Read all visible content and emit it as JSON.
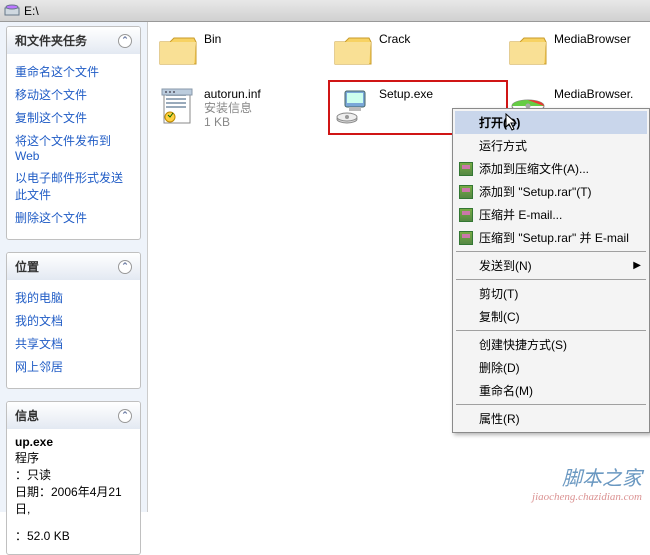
{
  "title": "E:\\",
  "sidebar": {
    "sections": [
      {
        "title": "和文件夹任务",
        "tasks": [
          "重命名这个文件",
          "移动这个文件",
          "复制这个文件",
          "将这个文件发布到 Web",
          "以电子邮件形式发送此文件",
          "删除这个文件"
        ]
      },
      {
        "title": "位置",
        "tasks": [
          "我的电脑",
          "我的文档",
          "共享文档",
          "网上邻居"
        ]
      },
      {
        "title": "信息",
        "details": {
          "name": "up.exe",
          "type": "程序",
          "attr": "：只读",
          "date": "日期：2006年4月21日,",
          "size": "：52.0 KB"
        }
      }
    ]
  },
  "items": {
    "folders": [
      {
        "name": "Bin"
      },
      {
        "name": "Crack"
      },
      {
        "name": "MediaBrowser"
      }
    ],
    "files": [
      {
        "name": "autorun.inf",
        "l2": "安装信息",
        "l3": "1 KB"
      },
      {
        "name": "Setup.exe",
        "l2": "",
        "l3": ""
      },
      {
        "name": "MediaBrowser.",
        "l2": "",
        "l3": ""
      }
    ]
  },
  "menu": {
    "open": "打开(O)",
    "runas": "运行方式",
    "rar1": "添加到压缩文件(A)...",
    "rar2": "添加到 \"Setup.rar\"(T)",
    "rar3": "压缩并 E-mail...",
    "rar4": "压缩到 \"Setup.rar\" 并 E-mail",
    "sendto": "发送到(N)",
    "cut": "剪切(T)",
    "copy": "复制(C)",
    "shortcut": "创建快捷方式(S)",
    "delete": "删除(D)",
    "rename": "重命名(M)",
    "props": "属性(R)"
  },
  "watermark": {
    "l1": "脚本之家",
    "l2": "jiaocheng.chazidian.com"
  }
}
